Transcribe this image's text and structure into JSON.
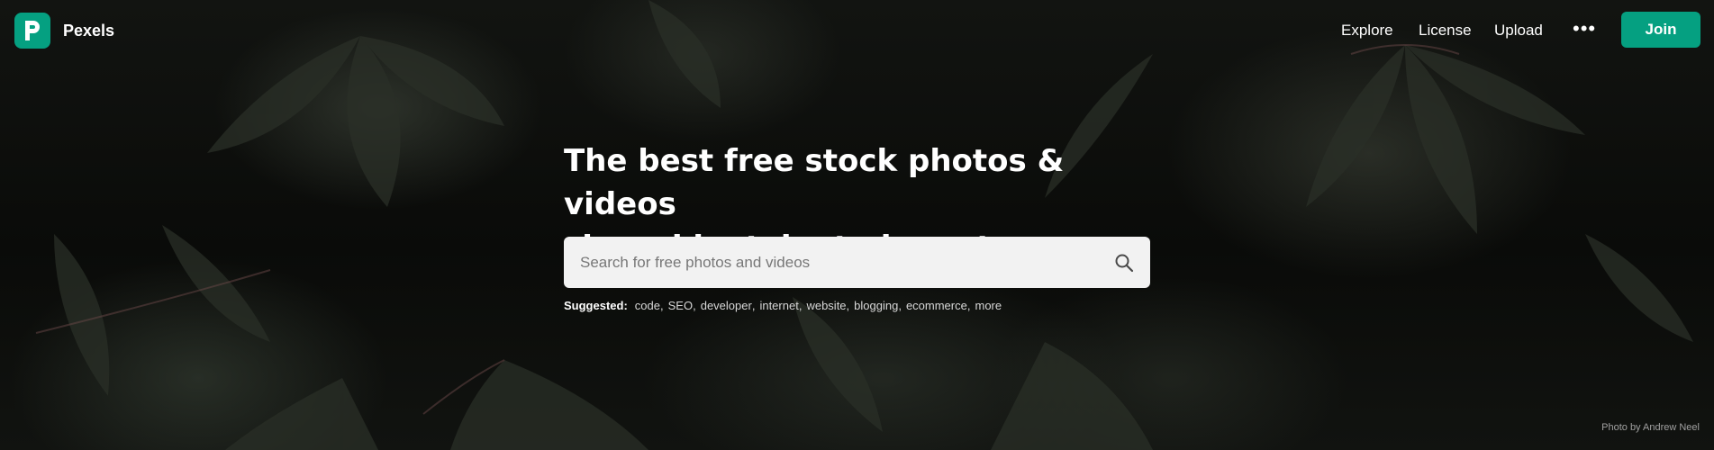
{
  "header": {
    "brand": "Pexels",
    "nav": [
      "Explore",
      "License",
      "Upload"
    ],
    "more_label": "•••",
    "join_label": "Join"
  },
  "hero": {
    "headline_line1": "The best free stock photos & videos",
    "headline_line2": "shared by talented creators.",
    "search_placeholder": "Search for free photos and videos",
    "suggested_label": "Suggested:",
    "suggested_tags": [
      "code",
      "SEO",
      "developer",
      "internet",
      "website",
      "blogging",
      "ecommerce",
      "more"
    ],
    "photo_credit": "Photo by Andrew Neel"
  },
  "colors": {
    "brand_green": "#05a081",
    "search_bg": "#f2f2f2"
  }
}
